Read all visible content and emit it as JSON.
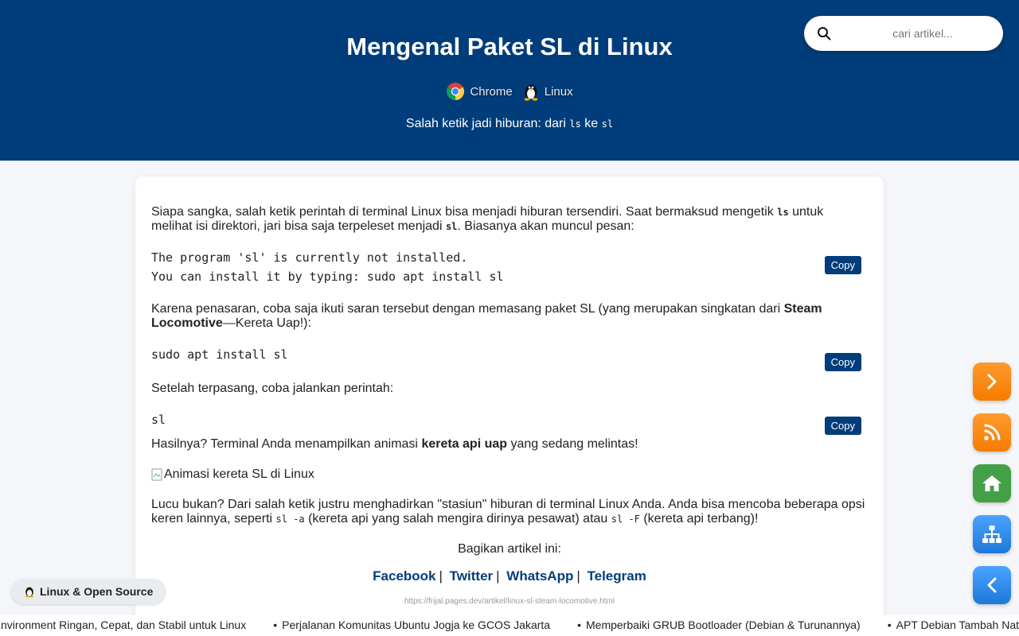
{
  "header": {
    "title": "Mengenal Paket SL di Linux",
    "tags": [
      {
        "icon": "chrome-icon",
        "label": "Chrome"
      },
      {
        "icon": "tux-penguin-icon",
        "label": "Linux"
      }
    ],
    "subtitle_pre": "Salah ketik jadi hiburan: dari ",
    "subtitle_code1": "ls",
    "subtitle_mid": " ke ",
    "subtitle_code2": "sl"
  },
  "search": {
    "placeholder": "cari artikel..."
  },
  "article": {
    "p1_a": "Siapa sangka, salah ketik perintah di terminal Linux bisa menjadi hiburan tersendiri. Saat bermaksud mengetik ",
    "p1_code1": "ls",
    "p1_b": " untuk melihat isi direktori, jari bisa saja terpeleset menjadi ",
    "p1_code2": "sl",
    "p1_c": ". Biasanya akan muncul pesan:",
    "code1_line1": "The program 'sl' is currently not installed.",
    "code1_line2": "You can install it by typing: sudo apt install sl",
    "p2_a": "Karena penasaran, coba saja ikuti saran tersebut dengan memasang paket SL (yang merupakan singkatan dari ",
    "p2_bold": "Steam Locomotive",
    "p2_b": "—Kereta Uap!):",
    "code2": "sudo apt install sl",
    "p3": "Setelah terpasang, coba jalankan perintah:",
    "code3": "sl",
    "p4_a": "Hasilnya? Terminal Anda menampilkan animasi ",
    "p4_bold": "kereta api uap",
    "p4_b": " yang sedang melintas!",
    "img_alt": "Animasi kereta SL di Linux",
    "p5_a": "Lucu bukan? Dari salah ketik justru menghadirkan \"stasiun\" hiburan di terminal Linux Anda. Anda bisa mencoba beberapa opsi keren lainnya, seperti ",
    "p5_code1": "sl -a",
    "p5_b": " (kereta api yang salah mengira dirinya pesawat) atau ",
    "p5_code2": "sl -F",
    "p5_c": " (kereta api terbang)!",
    "copy_label": "Copy",
    "share_title": "Bagikan artikel ini:",
    "share": {
      "facebook": "Facebook",
      "twitter": "Twitter",
      "whatsapp": "WhatsApp",
      "telegram": "Telegram",
      "sep": "|"
    },
    "url": "https://frijal.pages.dev/artikel/linux-sl-steam-locomotive.html"
  },
  "fabs": [
    {
      "icon": "chevron-right-icon",
      "color": "#f57c00"
    },
    {
      "icon": "rss-icon",
      "color": "#f57c00"
    },
    {
      "icon": "home-icon",
      "color": "#43a047"
    },
    {
      "icon": "sitemap-icon",
      "color": "#1e78d8"
    },
    {
      "icon": "chevron-left-icon",
      "color": "#1e78d8"
    }
  ],
  "category_badge": {
    "icon": "tux-penguin-icon",
    "label": "Linux & Open Source"
  },
  "ticker": [
    "o Environment Ringan, Cepat, dan Stabil untuk Linux",
    "Perjalanan Komunitas Ubuntu Jogja ke GCOS Jakarta",
    "Memperbaiki GRUB Bootloader (Debian & Turunannya)",
    "APT Debian Tambah Native"
  ]
}
